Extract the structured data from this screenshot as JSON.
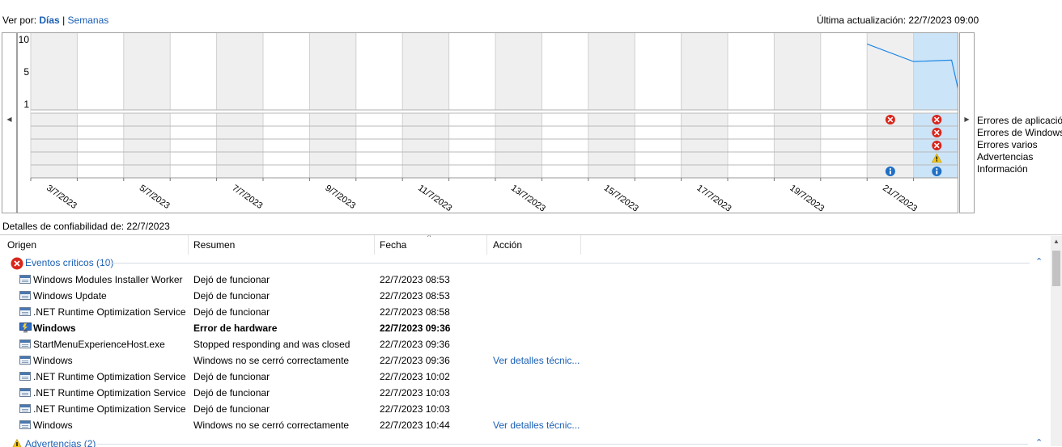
{
  "header": {
    "view_by_label": "Ver por:",
    "days_label": "Días",
    "separator": "|",
    "weeks_label": "Semanas",
    "last_update": "Última actualización: 22/7/2023 09:00"
  },
  "chart_data": {
    "type": "line",
    "title": "",
    "ylabel": "",
    "ylim": [
      1,
      10
    ],
    "y_ticks": [
      "10",
      "5",
      "1"
    ],
    "x_dates": [
      "3/7/2023",
      "5/7/2023",
      "7/7/2023",
      "9/7/2023",
      "11/7/2023",
      "13/7/2023",
      "15/7/2023",
      "17/7/2023",
      "19/7/2023",
      "21/7/2023"
    ],
    "stability_index": [
      {
        "day": "21/7/2023",
        "value": 9.6
      },
      {
        "day": "21/7/2023 (fin)",
        "value": 7.1
      },
      {
        "day": "22/7/2023",
        "value": 7.3
      },
      {
        "day": "22/7/2023 (fin)",
        "value": 3.0
      }
    ],
    "event_marks": [
      {
        "day": "21/7/2023",
        "row": "errores_aplicacion",
        "kind": "error"
      },
      {
        "day": "21/7/2023",
        "row": "informacion",
        "kind": "info"
      },
      {
        "day": "22/7/2023",
        "row": "errores_aplicacion",
        "kind": "error"
      },
      {
        "day": "22/7/2023",
        "row": "errores_windows",
        "kind": "error"
      },
      {
        "day": "22/7/2023",
        "row": "errores_varios",
        "kind": "error"
      },
      {
        "day": "22/7/2023",
        "row": "advertencias",
        "kind": "warning"
      },
      {
        "day": "22/7/2023",
        "row": "informacion",
        "kind": "info"
      }
    ],
    "series_color": "#1e88e5",
    "selected_day": "22/7/2023",
    "selected_color": "#cce4f7"
  },
  "legend": {
    "errores_aplicacion": "Errores de aplicación",
    "errores_windows": "Errores de Windows",
    "errores_varios": "Errores varios",
    "advertencias": "Advertencias",
    "informacion": "Información"
  },
  "details": {
    "label": "Detalles de confiabilidad de: 22/7/2023"
  },
  "table": {
    "columns": [
      "Origen",
      "Resumen",
      "Fecha",
      "Acción"
    ],
    "critical_group": "Eventos críticos (10)",
    "warnings_group": "Advertencias (2)",
    "rows": [
      {
        "origen": "Windows Modules Installer Worker",
        "resumen": "Dejó de funcionar",
        "fecha": "22/7/2023 08:53",
        "accion": "",
        "icon": "app-window-icon"
      },
      {
        "origen": "Windows Update",
        "resumen": "Dejó de funcionar",
        "fecha": "22/7/2023 08:53",
        "accion": "",
        "icon": "app-window-icon"
      },
      {
        "origen": ".NET Runtime Optimization Service",
        "resumen": "Dejó de funcionar",
        "fecha": "22/7/2023 08:58",
        "accion": "",
        "icon": "app-window-icon"
      },
      {
        "origen": "Windows",
        "resumen": "Error de hardware",
        "fecha": "22/7/2023 09:36",
        "accion": "",
        "icon": "hardware-monitor-icon",
        "bold": true
      },
      {
        "origen": "StartMenuExperienceHost.exe",
        "resumen": "Stopped responding and was closed",
        "fecha": "22/7/2023 09:36",
        "accion": "",
        "icon": "app-window-icon"
      },
      {
        "origen": "Windows",
        "resumen": "Windows no se cerró correctamente",
        "fecha": "22/7/2023 09:36",
        "accion": "Ver detalles técnic...",
        "icon": "app-window-icon"
      },
      {
        "origen": ".NET Runtime Optimization Service",
        "resumen": "Dejó de funcionar",
        "fecha": "22/7/2023 10:02",
        "accion": "",
        "icon": "app-window-icon"
      },
      {
        "origen": ".NET Runtime Optimization Service",
        "resumen": "Dejó de funcionar",
        "fecha": "22/7/2023 10:03",
        "accion": "",
        "icon": "app-window-icon"
      },
      {
        "origen": ".NET Runtime Optimization Service",
        "resumen": "Dejó de funcionar",
        "fecha": "22/7/2023 10:03",
        "accion": "",
        "icon": "app-window-icon"
      },
      {
        "origen": "Windows",
        "resumen": "Windows no se cerró correctamente",
        "fecha": "22/7/2023 10:44",
        "accion": "Ver detalles técnic...",
        "icon": "app-window-icon"
      }
    ]
  },
  "icons": {
    "error": "error-circle-icon",
    "warning": "warning-triangle-icon",
    "info": "info-circle-icon",
    "collapse": "chevron-up-icon",
    "sort": "sort-ascending-icon",
    "nav_left": "chevron-left-icon",
    "nav_right": "chevron-right-icon"
  }
}
